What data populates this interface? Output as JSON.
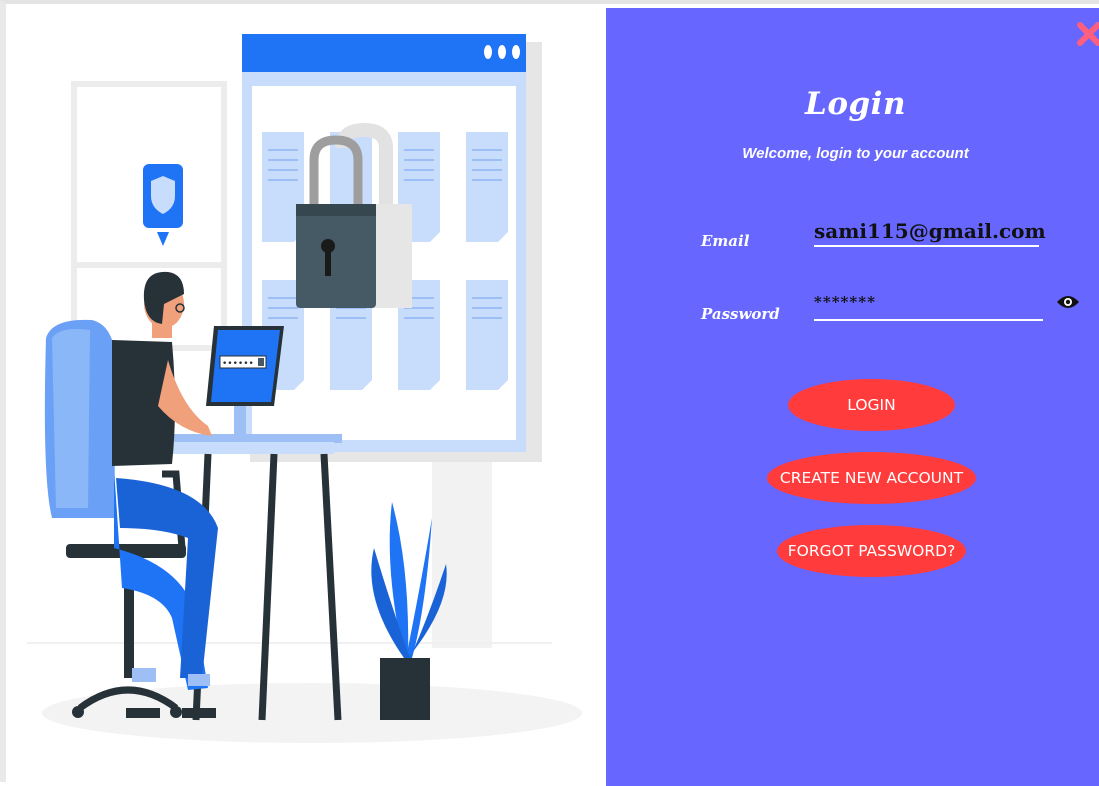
{
  "login": {
    "title": "Login",
    "subtitle": "Welcome, login to your account",
    "email_label": "Email",
    "email_value": "sami115@gmail.com",
    "password_label": "Password",
    "password_value": "*******",
    "login_button": "LOGIN",
    "create_account_button": "CREATE NEW ACCOUNT",
    "forgot_password_button": "FORGOT PASSWORD?"
  },
  "illustration": {
    "laptop_screen_text": "••••••"
  },
  "icons": {
    "close": "close-icon",
    "password_visibility": "eye-icon",
    "shield": "shield-icon",
    "padlock": "padlock-icon"
  },
  "colors": {
    "panel_background": "#6766ff",
    "button_background": "#ff3b3b",
    "close_icon": "#ff5f7e",
    "illustration_blue": "#1e74f5",
    "illustration_light_blue": "#c8dcfb",
    "illustration_dark": "#263238"
  }
}
